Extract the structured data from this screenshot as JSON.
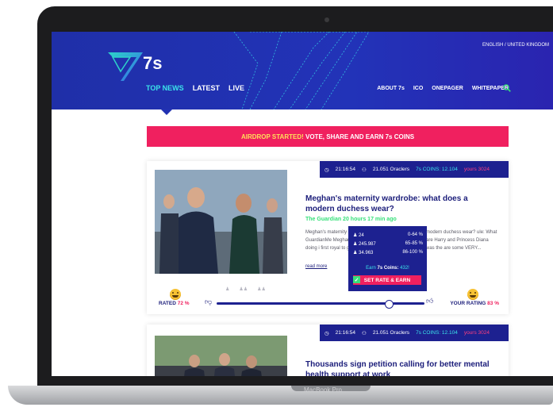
{
  "device": {
    "label": "MacBook Pro"
  },
  "header": {
    "logo_text": "7s",
    "locale": "ENGLISH / UNITED KINGDOM",
    "nav_left": [
      "TOP NEWS",
      "LATEST",
      "LIVE"
    ],
    "nav_right": [
      "ABOUT 7s",
      "ICO",
      "ONEPAGER",
      "WHITEPAPER"
    ],
    "search_icon": "search-icon"
  },
  "banner": {
    "accent": "AIRDROP STARTED!",
    "text": "VOTE, SHARE AND EARN 7s COINS"
  },
  "cards": [
    {
      "time": "21:16:54",
      "oracles": "21.051 Oraclers",
      "coins_label": "7s COINS: 12.104",
      "yours": "yours 3024",
      "title": "Meghan's maternity wardrobe: what does a modern duchess wear?",
      "source": "The Guardian 20 hours 17 min ago",
      "snippet_left": "Meghan's maternity The GuardianMe Meghan doing i first royal to give",
      "snippet_right": "modern duchess wear? ule: What are Harry and Princess Diana was the are some VERY...",
      "read_more": "read more",
      "popup": {
        "rows": [
          {
            "value": "24",
            "range": "0-64 %"
          },
          {
            "value": "245.987",
            "range": "65-85 %"
          },
          {
            "value": "34.963",
            "range": "86-100 %"
          }
        ],
        "earn": "Earn 7s Coins: 432!",
        "earn_prefix": "Earn",
        "earn_bold": "7s Coins:",
        "earn_suffix": "432!",
        "button": "SET RATE & EARN"
      },
      "rated_label": "RATED",
      "rated_pct": "72 %",
      "your_rating_label": "YOUR RATING",
      "your_rating_pct": "83 %",
      "slider_value": 0.83
    },
    {
      "time": "21:16:54",
      "oracles": "21.051 Oraclers",
      "coins_label": "7s COINS: 12.104",
      "yours": "yours 3024",
      "title": "Thousands sign petition calling for better mental health support at work"
    }
  ]
}
